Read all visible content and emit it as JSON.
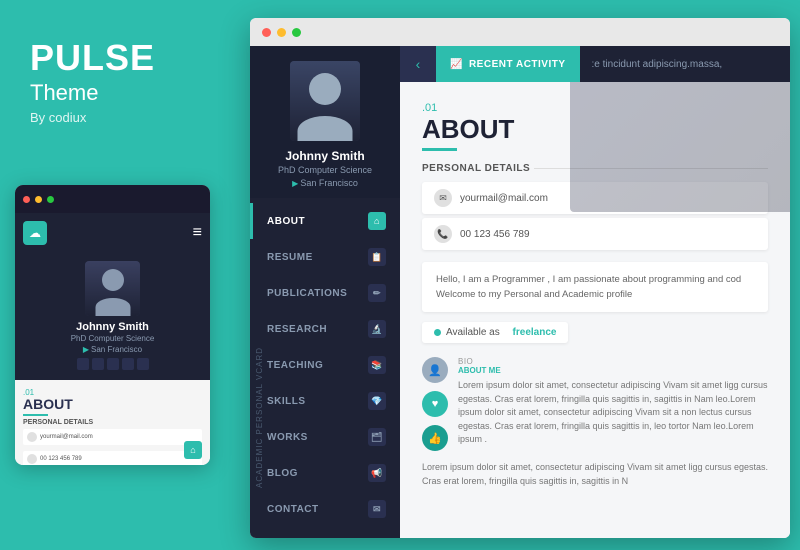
{
  "brand": {
    "name": "PULSE",
    "subtitle": "Theme",
    "author": "By codiux"
  },
  "mobile": {
    "name": "Johnny Smith",
    "degree": "PhD Computer Science",
    "location": "San Francisco",
    "about_num": ".01",
    "about_title": "ABOUT",
    "personal_details": "PERSONAL DETAILS",
    "email": "yourmail@mail.com",
    "phone": "00 123 456 789"
  },
  "sidebar": {
    "name": "Johnny Smith",
    "degree": "PhD Computer Science",
    "location": "San Francisco",
    "label": "ACADEMIC PERSONAL VCARD",
    "nav": [
      {
        "label": "ABOUT",
        "active": true,
        "icon": "🏠"
      },
      {
        "label": "RESUME",
        "active": false,
        "icon": "📋"
      },
      {
        "label": "PUBLICATIONS",
        "active": false,
        "icon": "✏️"
      },
      {
        "label": "RESEARCH",
        "active": false,
        "icon": "🔬"
      },
      {
        "label": "TEACHING",
        "active": false,
        "icon": "📚"
      },
      {
        "label": "SKILLS",
        "active": false,
        "icon": "💎"
      },
      {
        "label": "WORKS",
        "active": false,
        "icon": "🗂️"
      },
      {
        "label": "BLOG",
        "active": false,
        "icon": "📢"
      },
      {
        "label": "CONTACT",
        "active": false,
        "icon": "✉️"
      }
    ]
  },
  "header": {
    "back": "‹",
    "recent_activity": "RECENT ACTIVITY",
    "preview_text": ":e tincidunt adipiscing.massa,"
  },
  "content": {
    "section_num": ".01",
    "section_title": "ABOUT",
    "personal_details": "PERSONAL DETAILS",
    "email": "yourmail@mail.com",
    "phone": "00 123 456 789",
    "available_text": "Available as",
    "available_status": "freelance",
    "intro": "Hello, I am a Programmer , I am passionate about programming and cod Welcome to my Personal and Academic profile",
    "bio_label": "BIO",
    "bio_sublabel": "ABOUT ME",
    "bio_text1": "Lorem ipsum dolor sit amet, consectetur adipiscing Vivam sit amet ligg cursus egestas. Cras erat lorem, fringilla quis sagittis in, sagittis in Nam leo.Lorem ipsum dolor sit amet, consectetur adipiscing Vivam sit a non lectus cursus egestas. Cras erat lorem, fringilla quis sagittis in, leo tortor Nam leo.Lorem ipsum .",
    "bio_text2": "Lorem ipsum dolor sit amet, consectetur adipiscing Vivam sit amet ligg cursus egestas. Cras erat lorem, fringilla quis sagittis in, sagittis in N"
  },
  "icons": {
    "cloud": "☁",
    "location_pin": "▶",
    "activity_icon": "📈",
    "home_icon": "⌂",
    "envelope": "✉",
    "phone_icon": "📞",
    "person_icon": "👤",
    "heart_icon": "♥",
    "thumb_icon": "👍"
  }
}
